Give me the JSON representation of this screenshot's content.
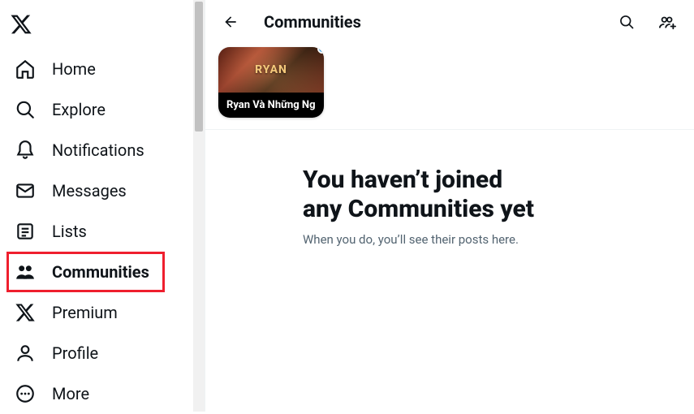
{
  "sidebar": {
    "items": [
      {
        "label": "Home"
      },
      {
        "label": "Explore"
      },
      {
        "label": "Notifications"
      },
      {
        "label": "Messages"
      },
      {
        "label": "Lists"
      },
      {
        "label": "Communities"
      },
      {
        "label": "Premium"
      },
      {
        "label": "Profile"
      },
      {
        "label": "More"
      }
    ]
  },
  "header": {
    "title": "Communities"
  },
  "community_card": {
    "name": "Ryan Và Những Ng",
    "thumb_text": "RYAN"
  },
  "empty": {
    "title_line1": "You haven’t joined",
    "title_line2": "any Communities yet",
    "subtitle": "When you do, you’ll see their posts here."
  }
}
